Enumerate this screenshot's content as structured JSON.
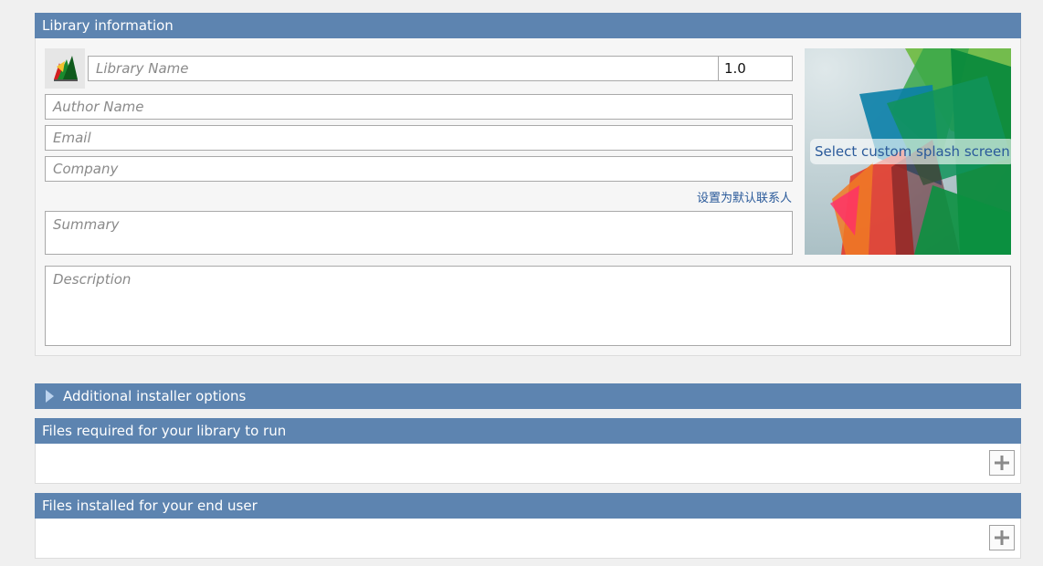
{
  "library_info": {
    "header": "Library information",
    "name_placeholder": "Library Name",
    "version": "1.0",
    "author_placeholder": "Author Name",
    "email_placeholder": "Email",
    "company_placeholder": "Company",
    "set_default_contact": "设置为默认联系人",
    "summary_placeholder": "Summary",
    "description_placeholder": "Description",
    "splash_label": "Select custom splash screen"
  },
  "additional_options": {
    "header": "Additional installer options",
    "expanded": false
  },
  "files_required": {
    "header": "Files required for your library to run",
    "add_icon": "plus-icon"
  },
  "files_installed": {
    "header": "Files installed for your end user",
    "add_icon": "plus-icon"
  },
  "colors": {
    "header_bg": "#5d84b0",
    "link": "#2a5a9a"
  }
}
